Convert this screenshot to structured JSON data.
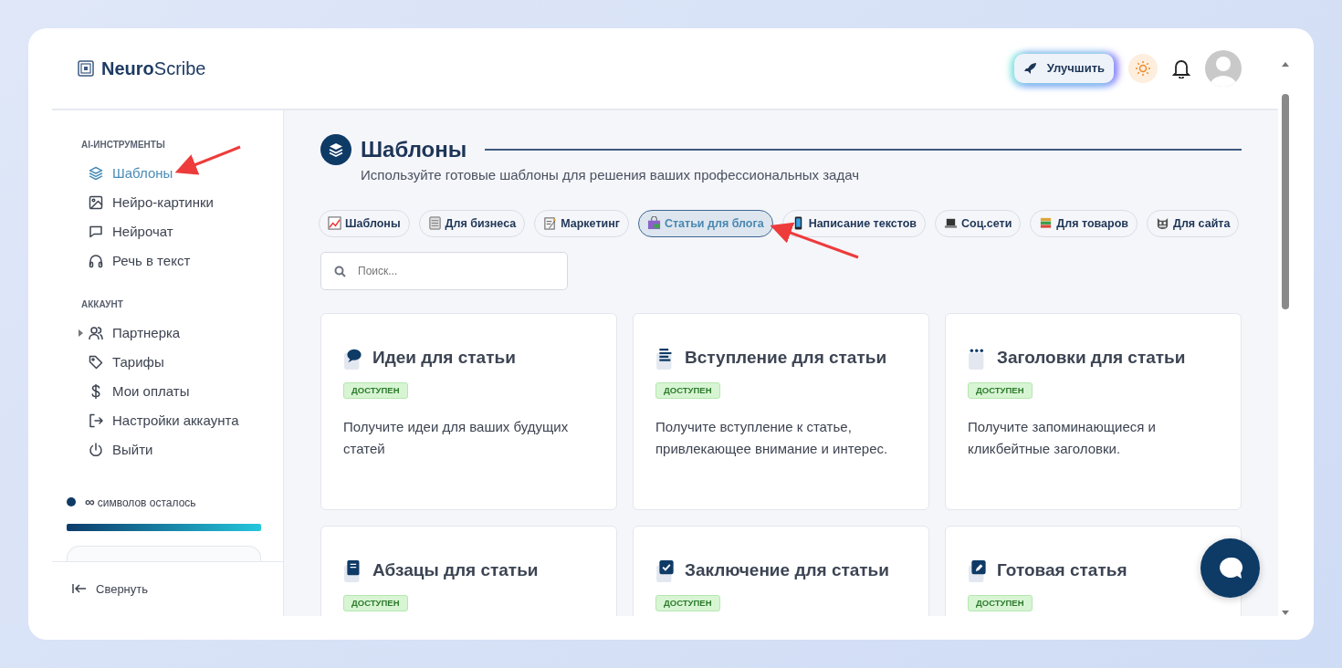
{
  "header": {
    "logo": "**Neuro**Scribe",
    "upgrade_button": "Улучшить"
  },
  "sidebar": {
    "sections": [
      {
        "title": "AI-ИНСТРУМЕНТЫ",
        "items": [
          {
            "label": "Шаблоны",
            "kind": "link",
            "selected": true
          },
          {
            "label": "Нейро-картинки",
            "kind": "link",
            "selected": false
          },
          {
            "label": "Нейрочат",
            "kind": "link",
            "selected": false
          },
          {
            "label": "Речь в текст",
            "kind": "link",
            "selected": false
          }
        ]
      },
      {
        "title": "АККАУНТ",
        "items": [
          {
            "label": "Партнерка",
            "kind": "group",
            "expanded": false,
            "selected": false
          },
          {
            "label": "Тарифы",
            "kind": "link",
            "selected": false
          },
          {
            "label": "Мои оплаты",
            "kind": "link",
            "selected": false
          },
          {
            "label": "Настройки аккаунта",
            "kind": "link",
            "selected": false
          },
          {
            "label": "Выйти",
            "kind": "link",
            "selected": false
          }
        ]
      }
    ],
    "usage": {
      "amount": "∞",
      "label": "символов осталось",
      "level": 1
    },
    "collapse": "Свернуть"
  },
  "page": {
    "title": "Шаблоны",
    "subtitle": "Используйте готовые шаблоны для решения ваших профессиональных задач",
    "categories": [
      {
        "label": "Шаблоны",
        "selected": false
      },
      {
        "label": "Для бизнеса",
        "selected": false
      },
      {
        "label": "Маркетинг",
        "selected": false
      },
      {
        "label": "Статьи для блога",
        "selected": true
      },
      {
        "label": "Написание текстов",
        "selected": false
      },
      {
        "label": "Соц.сети",
        "selected": false
      },
      {
        "label": "Для товаров",
        "selected": false
      },
      {
        "label": "Для сайта",
        "selected": false
      }
    ],
    "search": {
      "placeholder": "Поиск..."
    },
    "cards": [
      {
        "title": "Идеи для статьи",
        "status": "ДОСТУПЕН",
        "description": "Получите идеи для ваших будущих статей"
      },
      {
        "title": "Вступление для статьи",
        "status": "ДОСТУПЕН",
        "description": "Получите вступление к статье, привлекающее внимание и интерес."
      },
      {
        "title": "Заголовки для статьи",
        "status": "ДОСТУПЕН",
        "description": "Получите запоминающиеся и кликбейтные заголовки."
      },
      {
        "title": "Абзацы для статьи",
        "status": "ДОСТУПЕН"
      },
      {
        "title": "Заключение для статьи",
        "status": "ДОСТУПЕН"
      },
      {
        "title": "Готовая статья",
        "status": "ДОСТУПЕН"
      }
    ]
  }
}
